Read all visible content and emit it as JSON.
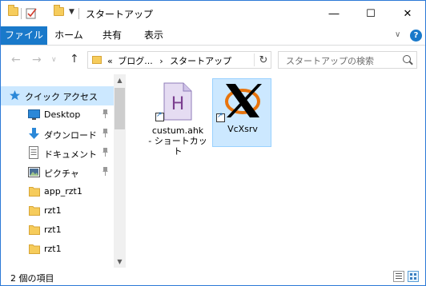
{
  "window": {
    "title": "スタートアップ",
    "minimize_label": "―",
    "maximize_label": "☐",
    "close_label": "✕"
  },
  "ribbon": {
    "tabs": [
      "ファイル",
      "ホーム",
      "共有",
      "表示"
    ],
    "help_label": "?"
  },
  "address": {
    "prefix": "«",
    "path": [
      "ブログ...",
      "スタートアップ"
    ],
    "separator": "›"
  },
  "search": {
    "placeholder": "スタートアップの検索"
  },
  "nav": {
    "quick_access": "クイック アクセス",
    "items": [
      {
        "label": "Desktop",
        "icon": "desktop-icon",
        "pinned": true
      },
      {
        "label": "ダウンロード",
        "icon": "download-icon",
        "pinned": true
      },
      {
        "label": "ドキュメント",
        "icon": "document-icon",
        "pinned": true
      },
      {
        "label": "ピクチャ",
        "icon": "pictures-icon",
        "pinned": true
      },
      {
        "label": "app_rzt1",
        "icon": "folder-icon",
        "pinned": false
      },
      {
        "label": "rzt1",
        "icon": "folder-icon",
        "pinned": false
      },
      {
        "label": "rzt1",
        "icon": "folder-icon",
        "pinned": false
      },
      {
        "label": "rzt1",
        "icon": "folder-icon",
        "pinned": false
      }
    ]
  },
  "files": [
    {
      "name_line1": "custum.ahk",
      "name_line2": "- ショートカッ",
      "name_line3": "ト",
      "icon": "autohotkey-script-icon"
    },
    {
      "name_line1": "VcXsrv",
      "name_line2": "",
      "name_line3": "",
      "icon": "vcxsrv-icon"
    }
  ],
  "status": {
    "count_text": "2 個の項目"
  },
  "colors": {
    "accent": "#1979ca",
    "selection": "#cce8ff",
    "folder": "#f6cc5c"
  }
}
